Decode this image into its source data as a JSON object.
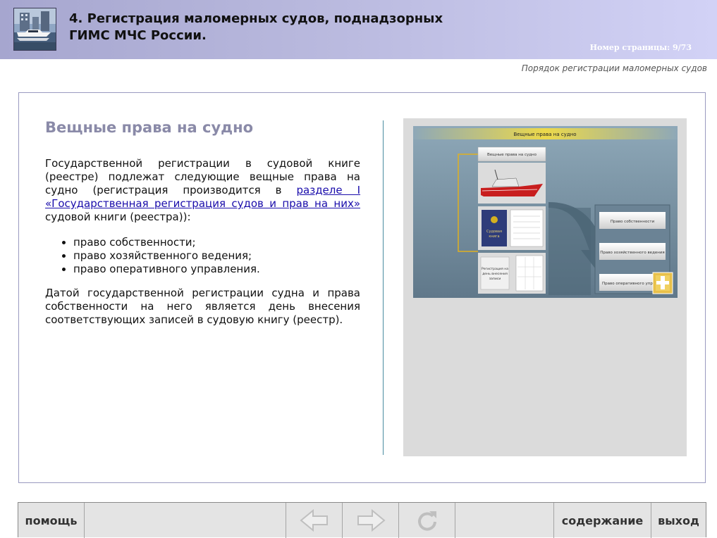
{
  "header": {
    "title_line1": "4. Регистрация маломерных судов, поднадзорных",
    "title_line2": "ГИМС МЧС России.",
    "page_label": "Номер страницы:",
    "page_value": "9/73"
  },
  "subtitle": "Порядок регистрации маломерных судов",
  "content": {
    "heading": "Вещные права на судно",
    "p1_before": "Государственной регистрации в судовой книге (реестре) подлежат следующие вещные права на судно (регистрация производится в ",
    "p1_link": "разделе I «Государственная регистрация судов и прав на них»",
    "p1_after": " судовой книги (реестра)):",
    "bullets": [
      "право собственности;",
      "право хозяйственного ведения;",
      "право оперативного управления."
    ],
    "p2": "Датой государственной регистрации судна и права собственности на него является день внесения соответствующих записей в судовую книгу (реестр)."
  },
  "diagram": {
    "title": "Вещные права на судно",
    "box_top": "Вещные права на судно",
    "book_label_1": "Судовая",
    "book_label_2": "книга",
    "record_1": "Регистрация на",
    "record_2": "день внесения",
    "record_3": "записи",
    "right_1": "Право собственности",
    "right_2": "Право хозяйственного ведения",
    "right_3": "Право оперативного управл..."
  },
  "footer": {
    "help": "помощь",
    "contents": "содержание",
    "exit": "выход"
  },
  "icons": {
    "back": "arrow-left-icon",
    "forward": "arrow-right-icon",
    "reload": "reload-icon",
    "zoom": "plus-icon"
  },
  "colors": {
    "header_start": "#a6a6cf",
    "header_end": "#d2d2f6",
    "heading": "#8a8aa8",
    "link": "#1a0dab",
    "divider": "#4a8ca0",
    "diagram_title_bar": "#e8d84a",
    "connector": "#e0b020"
  }
}
